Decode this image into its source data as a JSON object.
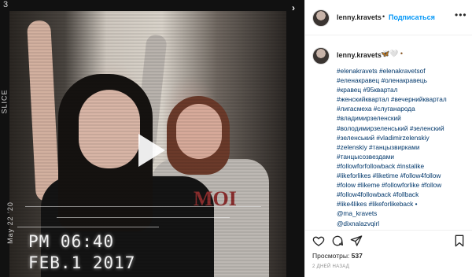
{
  "media": {
    "corner_label": "3",
    "side_label_top": "SLICE",
    "side_label_bottom": "May  22  '20",
    "stamp_time": "PM 06:40",
    "stamp_date": "FEB.1 2017",
    "sweater_text": "MOI",
    "nav_arrow": "›"
  },
  "header": {
    "username": "lenny.kravets",
    "separator": "•",
    "follow_label": "Подписаться",
    "more_label": "•••"
  },
  "caption": {
    "username": "lenny.kravets",
    "emoji": "🦋🤍 •",
    "lines": [
      "#elenakravets #elenakravetsof",
      "#еленакравец #оленакравець",
      "#кравец #95квартал",
      "#женскийквартал #вечернийквартал",
      "#лигасмеха #слуганарода",
      "#владимирзеленский",
      "#володимирзеленський #зеленский",
      "#зеленський #vladimirzelenskiy",
      "#zelenskiy #танцызвирками",
      "#танцысозвездами",
      "#followforfollowback #instalike",
      "#likeforlikes #liketime #follow4follow",
      "#folow #likeme #followforlike #follow",
      "#follow4followback #follback",
      "#like4likes #likeforlikeback •",
      "@ma_kravets",
      "@dixnalazvqirl"
    ]
  },
  "stats": {
    "views_label": "Просмотры:",
    "views_count": "537",
    "time_ago": "2 ДНЕЙ НАЗАД"
  },
  "icons": {
    "like": "heart-icon",
    "comment": "comment-icon",
    "share": "share-icon",
    "save": "bookmark-icon"
  }
}
